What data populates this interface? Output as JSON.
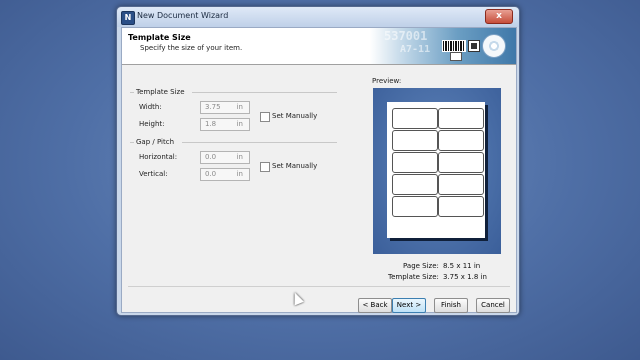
{
  "window": {
    "title": "New Document Wizard",
    "app_icon": "app-icon",
    "close_icon": "close-icon",
    "close_glyph": "x"
  },
  "header": {
    "title": "Template Size",
    "subtitle": "Specify the size of your item.",
    "banner_text_1": "537001",
    "banner_text_2": "A7-11"
  },
  "template_size": {
    "group_label": "Template Size",
    "width_label": "Width:",
    "width_value": "3.75",
    "width_unit": "in",
    "height_label": "Height:",
    "height_value": "1.8",
    "height_unit": "in",
    "set_manually_label": "Set Manually"
  },
  "gap_pitch": {
    "group_label": "Gap / Pitch",
    "horizontal_label": "Horizontal:",
    "horizontal_value": "0.0",
    "horizontal_unit": "in",
    "vertical_label": "Vertical:",
    "vertical_value": "0.0",
    "vertical_unit": "in",
    "set_manually_label": "Set Manually"
  },
  "preview": {
    "label": "Preview:",
    "page_size_label": "Page Size:",
    "page_size_value": "8.5 x 11 in",
    "template_size_label": "Template Size:",
    "template_size_value": "3.75 x 1.8 in"
  },
  "buttons": {
    "back": "< Back",
    "next": "Next >",
    "finish": "Finish",
    "cancel": "Cancel"
  },
  "colors": {
    "desktop": "#4f6fa6",
    "preview_bg": "#3b5f9a",
    "accent": "#3c7fb1"
  }
}
